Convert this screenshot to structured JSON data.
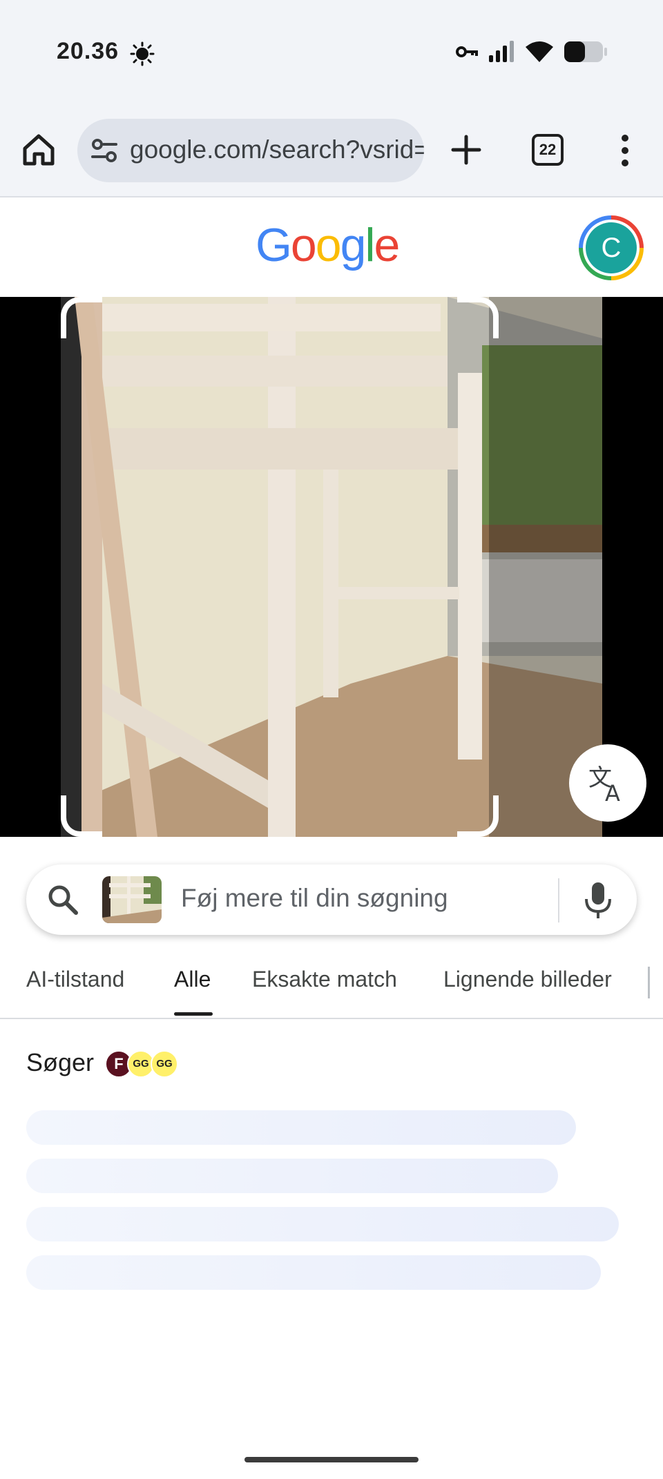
{
  "status_bar": {
    "time": "20.36",
    "icons": [
      "sun-icon",
      "vpn-key-icon",
      "signal-icon",
      "wifi-icon",
      "battery-icon"
    ]
  },
  "browser": {
    "url": "google.com/search?vsrid=",
    "tab_count": "22",
    "icons": [
      "home-icon",
      "tune-icon",
      "plus-icon",
      "tabs-icon",
      "more-vert-icon"
    ]
  },
  "header": {
    "logo_text": [
      "G",
      "o",
      "o",
      "g",
      "l",
      "e"
    ],
    "logo_colors": [
      "#4285f4",
      "#ea4335",
      "#fbbc04",
      "#4285f4",
      "#34a853",
      "#ea4335"
    ],
    "avatar_letter": "C",
    "avatar_color": "#1aa39c"
  },
  "lens": {
    "image_description_icon": "loft-bed-photo",
    "translate_icon": "translate-icon"
  },
  "search": {
    "placeholder": "Føj mere til din søgning",
    "icons": [
      "search-icon",
      "mic-icon"
    ]
  },
  "tabs": [
    {
      "label": "AI-tilstand",
      "active": false
    },
    {
      "label": "Alle",
      "active": true
    },
    {
      "label": "Eksakte match",
      "active": false
    },
    {
      "label": "Lignende billeder",
      "active": false
    }
  ],
  "results": {
    "searching_label": "Søger",
    "source_badges": [
      {
        "label": "F",
        "color": "#5a1120",
        "text_color": "#ffffff"
      },
      {
        "label": "GG",
        "color": "#fff06a",
        "text_color": "#222222"
      },
      {
        "label": "GG",
        "color": "#fff06a",
        "text_color": "#222222"
      }
    ]
  },
  "colors": {
    "accent": "#1a73e8",
    "browser_bg": "#f2f4f8",
    "skeleton": "#eef2fc"
  }
}
